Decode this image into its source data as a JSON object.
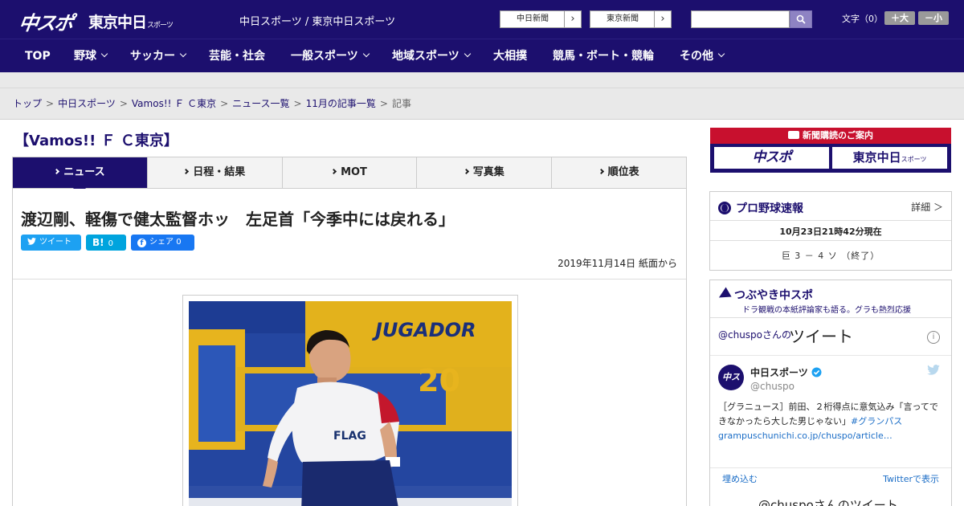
{
  "header": {
    "logo_chuspo": "中スポ",
    "logo_tokyo": "東京中日",
    "logo_tokyo_sub": "スポーツ",
    "site_name": "中日スポーツ / 東京中日スポーツ",
    "btn_chunichi": "中日新聞",
    "btn_tokyo": "東京新聞",
    "search_placeholder": "",
    "font_label": "文字（0）",
    "font_large": "＋大",
    "font_small": "－小"
  },
  "nav": [
    "TOP",
    "野球",
    "サッカー",
    "芸能・社会",
    "一般スポーツ",
    "地域スポーツ",
    "大相撲",
    "競馬・ボート・競輪",
    "その他"
  ],
  "breadcrumb": [
    "トップ",
    "中日スポーツ",
    "Vamos!! Ｆ Ｃ東京",
    "ニュース一覧",
    "11月の記事一覧",
    "記事"
  ],
  "section_title": "【Vamos!! Ｆ Ｃ東京】",
  "tabs": [
    "ニュース",
    "日程・結果",
    "MOT",
    "写真集",
    "順位表"
  ],
  "article": {
    "headline": "渡辺剛、軽傷で健太監督ホッ　左足首「今季中には戻れる」",
    "share_tweet": "ツイート",
    "share_hatena": "0",
    "share_fb_label": "シェア",
    "share_fb_count": "0",
    "date": "2019年11月14日 紙面から",
    "photo_sign_text": "JUGADOR",
    "photo_sign_num": "20",
    "photo_shirt_text": "FLAG"
  },
  "sidebar": {
    "ad_title": "新聞購読のご案内",
    "ad_chuspo": "中スポ",
    "ad_tokyo": "東京中日",
    "ad_tokyo_sub": "スポーツ",
    "baseball_title": "プロ野球速報",
    "baseball_detail": "詳細 ＞",
    "baseball_time": "10月23日21時42分現在",
    "baseball_score": "巨 3 － 4 ソ （終了）",
    "tweet_head": "つぶやき中スポ",
    "tweet_sub": "ドラ観戦の本紙評論家も語る。グラも熱烈応援",
    "tweet_handle": "@chuspoさんの",
    "tweet_big": "ツイート",
    "tweet_avatar": "中スポ",
    "tweet_name": "中日スポーツ",
    "tweet_user": "@chuspo",
    "tweet_text": "［グラニュース］前田、２桁得点に意気込み「言ってできなかったら大した男じゃない」",
    "tweet_tag": "#グランパス",
    "tweet_link": "grampuschunichi.co.jp/chuspo/article…",
    "tweet_embed": "埋め込む",
    "tweet_show": "Twitterで表示",
    "tweet_bottom": "@chuspoさんのツイート"
  },
  "colors": {
    "brand": "#1c0f6e",
    "accent_red": "#c8102e",
    "twitter": "#1da1f2",
    "hatena": "#00a4de",
    "facebook": "#1877f2"
  }
}
